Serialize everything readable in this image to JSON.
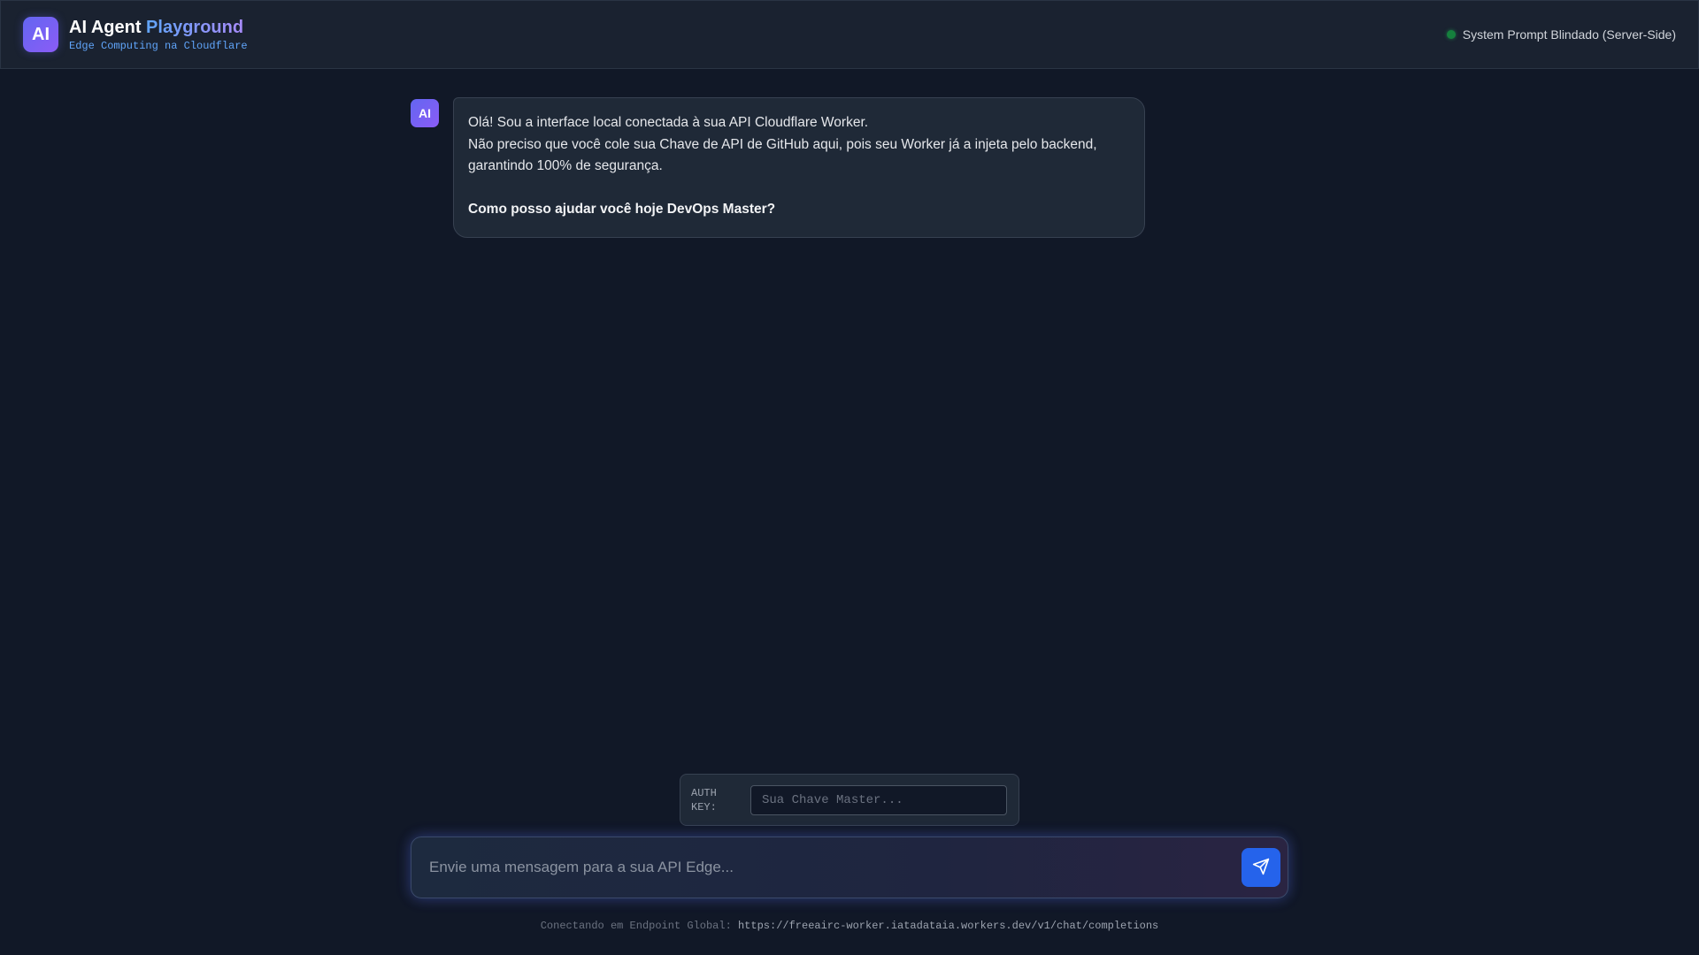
{
  "header": {
    "logo_text": "AI",
    "title_main": "AI Agent",
    "title_accent": "Playground",
    "subtitle": "Edge Computing na Cloudflare",
    "status_text": "System Prompt Blindado (Server-Side)",
    "status_color": "#15803d"
  },
  "chat": {
    "messages": [
      {
        "avatar": "AI",
        "lines": [
          "Olá! Sou a interface local conectada à sua API Cloudflare Worker.",
          "Não preciso que você cole sua Chave de API de GitHub aqui, pois seu Worker já a injeta pelo backend,",
          "garantindo 100% de segurança."
        ],
        "bold_line": "Como posso ajudar você hoje DevOps Master?"
      }
    ]
  },
  "auth": {
    "label_line1": "AUTH",
    "label_line2": "KEY:",
    "placeholder": "Sua Chave Master...",
    "value": ""
  },
  "composer": {
    "placeholder": "Envie uma mensagem para a sua API Edge...",
    "send_icon": "send-icon"
  },
  "footer": {
    "prefix": "Conectando em Endpoint Global:",
    "endpoint": "https://freeairc-worker.iatadataia.workers.dev/v1/chat/completions"
  },
  "colors": {
    "background": "#111827",
    "accent_blue": "#2563eb",
    "accent_purple": "#8b5cf6"
  }
}
